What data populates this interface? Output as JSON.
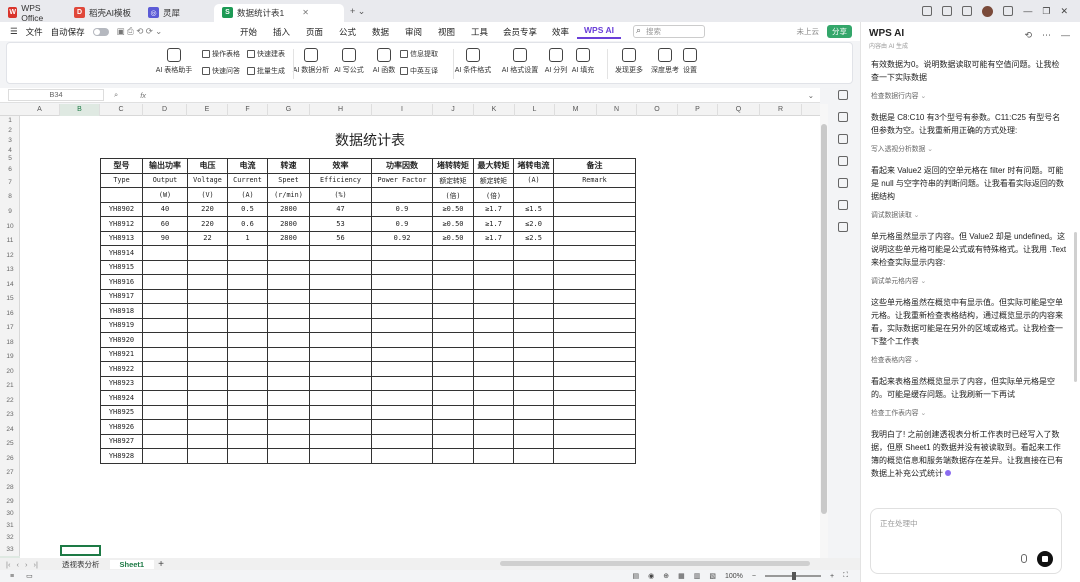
{
  "tabs": [
    {
      "label": "WPS Office",
      "logo": "W",
      "color": "#d9342b"
    },
    {
      "label": "稻壳AI模板",
      "logo": "D",
      "color": "#e0483a"
    },
    {
      "label": "灵犀",
      "logo": "◎",
      "color": "#5b5bd6"
    },
    {
      "label": "数据统计表1",
      "logo": "S",
      "color": "#1d9a55",
      "active": true
    }
  ],
  "menubar": {
    "file": "文件",
    "autosave": "自动保存",
    "items": [
      "开始",
      "插入",
      "页面",
      "公式",
      "数据",
      "审阅",
      "视图",
      "工具",
      "会员专享",
      "效率"
    ],
    "wpsai": "WPS AI",
    "search_placeholder": "搜索",
    "cloud": "未上云",
    "share": "分享"
  },
  "ribbon": {
    "big": [
      {
        "label": "AI 表格助手",
        "name": "ai-table-assistant-button"
      },
      {
        "label": "AI 数据分析",
        "name": "ai-data-analysis-button"
      },
      {
        "label": "AI 写公式",
        "name": "ai-write-formula-button"
      },
      {
        "label": "AI 函数",
        "name": "ai-function-button"
      },
      {
        "label": "AI 条件格式",
        "name": "ai-conditional-format-button"
      },
      {
        "label": "AI 格式设置",
        "name": "ai-format-settings-button"
      },
      {
        "label": "AI 分列",
        "name": "ai-split-column-button"
      },
      {
        "label": "AI 填充",
        "name": "ai-fill-button"
      },
      {
        "label": "发现更多",
        "name": "discover-more-button"
      },
      {
        "label": "深度思考",
        "name": "deep-think-button"
      },
      {
        "label": "设置",
        "name": "settings-button"
      }
    ],
    "small": [
      {
        "label": "操作表格",
        "name": "operate-table-button"
      },
      {
        "label": "快速建表",
        "name": "quick-table-button"
      },
      {
        "label": "信息提取",
        "name": "info-extract-button"
      },
      {
        "label": "快速问答",
        "name": "quick-qa-button"
      },
      {
        "label": "批量生成",
        "name": "batch-generate-button"
      },
      {
        "label": "中英互译",
        "name": "translate-button"
      }
    ]
  },
  "formula": {
    "cell": "B34",
    "fx": "fx"
  },
  "columns": [
    "A",
    "B",
    "C",
    "D",
    "E",
    "F",
    "G",
    "H",
    "I",
    "J",
    "K",
    "L",
    "M",
    "N",
    "O",
    "P",
    "Q",
    "R"
  ],
  "rows": [
    "1",
    "2",
    "3",
    "4",
    "5",
    "6",
    "7",
    "8",
    "9",
    "10",
    "11",
    "12",
    "13",
    "14",
    "15",
    "16",
    "17",
    "18",
    "19",
    "20",
    "21",
    "22",
    "23",
    "24",
    "25",
    "26",
    "27",
    "28",
    "29",
    "30",
    "31",
    "32",
    "33",
    "34"
  ],
  "sheet": {
    "title": "数据统计表",
    "header_cn": [
      "型号",
      "输出功率",
      "电压",
      "电流",
      "转速",
      "效率",
      "功率因数",
      "堵转转矩",
      "最大转矩",
      "堵转电流",
      "备注"
    ],
    "header_en": [
      "Type",
      "Output",
      "Voltage",
      "Current",
      "Speet",
      "Efficiency",
      "Power Factor",
      "额定转矩",
      "额定转矩",
      "(A)",
      "Remark"
    ],
    "header_unit": [
      "",
      "(W)",
      "(V)",
      "(A)",
      "(r/min)",
      "(%)",
      "",
      "(倍)",
      "(倍)",
      "",
      ""
    ],
    "data": [
      [
        "YH8902",
        "40",
        "220",
        "0.5",
        "2800",
        "47",
        "0.9",
        "≥0.50",
        "≥1.7",
        "≤1.5",
        ""
      ],
      [
        "YH8912",
        "60",
        "220",
        "0.6",
        "2800",
        "53",
        "0.9",
        "≥0.50",
        "≥1.7",
        "≤2.0",
        ""
      ],
      [
        "YH8913",
        "90",
        "22",
        "1",
        "2800",
        "56",
        "0.92",
        "≥0.50",
        "≥1.7",
        "≤2.5",
        ""
      ],
      [
        "YH8914",
        "",
        "",
        "",
        "",
        "",
        "",
        "",
        "",
        "",
        ""
      ],
      [
        "YH8915",
        "",
        "",
        "",
        "",
        "",
        "",
        "",
        "",
        "",
        ""
      ],
      [
        "YH8916",
        "",
        "",
        "",
        "",
        "",
        "",
        "",
        "",
        "",
        ""
      ],
      [
        "YH8917",
        "",
        "",
        "",
        "",
        "",
        "",
        "",
        "",
        "",
        ""
      ],
      [
        "YH8918",
        "",
        "",
        "",
        "",
        "",
        "",
        "",
        "",
        "",
        ""
      ],
      [
        "YH8919",
        "",
        "",
        "",
        "",
        "",
        "",
        "",
        "",
        "",
        ""
      ],
      [
        "YH8920",
        "",
        "",
        "",
        "",
        "",
        "",
        "",
        "",
        "",
        ""
      ],
      [
        "YH8921",
        "",
        "",
        "",
        "",
        "",
        "",
        "",
        "",
        "",
        ""
      ],
      [
        "YH8922",
        "",
        "",
        "",
        "",
        "",
        "",
        "",
        "",
        "",
        ""
      ],
      [
        "YH8923",
        "",
        "",
        "",
        "",
        "",
        "",
        "",
        "",
        "",
        ""
      ],
      [
        "YH8924",
        "",
        "",
        "",
        "",
        "",
        "",
        "",
        "",
        "",
        ""
      ],
      [
        "YH8925",
        "",
        "",
        "",
        "",
        "",
        "",
        "",
        "",
        "",
        ""
      ],
      [
        "YH8926",
        "",
        "",
        "",
        "",
        "",
        "",
        "",
        "",
        "",
        ""
      ],
      [
        "YH8927",
        "",
        "",
        "",
        "",
        "",
        "",
        "",
        "",
        "",
        ""
      ],
      [
        "YH8928",
        "",
        "",
        "",
        "",
        "",
        "",
        "",
        "",
        "",
        ""
      ]
    ]
  },
  "sheettabs": [
    "透视表分析",
    "Sheet1"
  ],
  "status": {
    "zoom": "100%"
  },
  "ai": {
    "title": "WPS AI",
    "subtitle": "内容由 AI 生成",
    "messages": [
      {
        "type": "text",
        "text": "有效数据为0。说明数据读取可能有空值问题。让我检查一下实际数据"
      },
      {
        "type": "step",
        "text": "检查数据行内容"
      },
      {
        "type": "text",
        "text": "数据是 C8:C10 有3个型号有参数。C11:C25 有型号名但参数为空。让我重新用正确的方式处理:"
      },
      {
        "type": "step",
        "text": "写入透视分析数据"
      },
      {
        "type": "text",
        "text": "看起来 Value2 返回的空单元格在 filter 时有问题。可能是 null 与空字符串的判断问题。让我看看实际返回的数据结构"
      },
      {
        "type": "step",
        "text": "调试数据读取"
      },
      {
        "type": "text",
        "text": "单元格虽然显示了内容。但 Value2 却是 undefined。这说明这些单元格可能是公式或有特殊格式。让我用 .Text 来检查实际显示内容:"
      },
      {
        "type": "step",
        "text": "调试单元格内容"
      },
      {
        "type": "text",
        "text": "这些单元格虽然在概览中有显示值。但实际可能是空单元格。让我重新检查表格结构，通过概览显示的内容来看，实际数据可能是在另外的区域或格式。让我检查一下整个工作表"
      },
      {
        "type": "step",
        "text": "检查表格内容"
      },
      {
        "type": "text",
        "text": "看起来表格虽然概览显示了内容，但实际单元格是空的。可能是缓存问题。让我刷新一下再试"
      },
      {
        "type": "step",
        "text": "检查工作表内容"
      },
      {
        "type": "text",
        "text": "我明白了! 之前创建透视表分析工作表时已经写入了数据，但原 Sheet1 的数据并没有被读取到。看起来工作簿的概览信息和服务端数据存在差异。让我直接在已有数据上补充公式统计",
        "loading": true
      }
    ],
    "input_placeholder": "正在处理中"
  }
}
